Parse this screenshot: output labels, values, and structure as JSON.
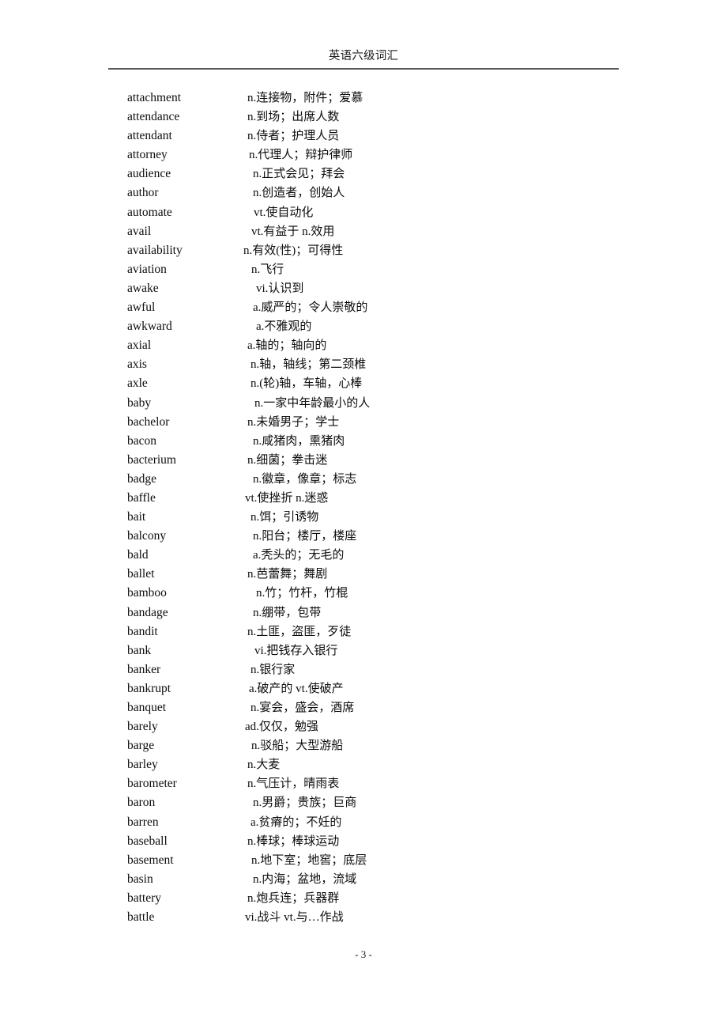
{
  "header": {
    "title": "英语六级词汇",
    "rule_color": "#595959"
  },
  "footer": {
    "page_label": "- 3 -"
  },
  "glossary": {
    "columns": [
      "word",
      "definition"
    ],
    "entries": [
      {
        "word": "attachment",
        "definition": "n.连接物，附件；爱慕",
        "indent": 313
      },
      {
        "word": "attendance",
        "definition": "n.到场；出席人数",
        "indent": 313
      },
      {
        "word": "attendant",
        "definition": "n.侍者；护理人员",
        "indent": 313
      },
      {
        "word": "attorney",
        "definition": "n.代理人；辩护律师",
        "indent": 315
      },
      {
        "word": "audience",
        "definition": "n.正式会见；拜会",
        "indent": 320
      },
      {
        "word": "author",
        "definition": "n.创造者，创始人",
        "indent": 320
      },
      {
        "word": "automate",
        "definition": "vt.使自动化",
        "indent": 321
      },
      {
        "word": "avail",
        "definition": "vt.有益于 n.效用",
        "indent": 318
      },
      {
        "word": "availability",
        "definition": "n.有效(性)；可得性",
        "indent": 308
      },
      {
        "word": "aviation",
        "definition": "n.飞行",
        "indent": 318
      },
      {
        "word": "awake",
        "definition": "vi.认识到",
        "indent": 324
      },
      {
        "word": "awful",
        "definition": "a.威严的；令人崇敬的",
        "indent": 320
      },
      {
        "word": "awkward",
        "definition": "a.不雅观的",
        "indent": 324
      },
      {
        "word": "axial",
        "definition": "a.轴的；轴向的",
        "indent": 313
      },
      {
        "word": "axis",
        "definition": "n.轴，轴线；第二颈椎",
        "indent": 317
      },
      {
        "word": "axle",
        "definition": "n.(轮)轴，车轴，心棒",
        "indent": 317
      },
      {
        "word": "baby",
        "definition": "n.一家中年龄最小的人",
        "indent": 322
      },
      {
        "word": "bachelor",
        "definition": "n.未婚男子；学士",
        "indent": 313
      },
      {
        "word": "bacon",
        "definition": "n.咸猪肉，熏猪肉",
        "indent": 320
      },
      {
        "word": "bacterium",
        "definition": "n.细菌；拳击迷",
        "indent": 313
      },
      {
        "word": "badge",
        "definition": "n.徽章，像章；标志",
        "indent": 320
      },
      {
        "word": "baffle",
        "definition": "vt.使挫折 n.迷惑",
        "indent": 310
      },
      {
        "word": "bait",
        "definition": "n.饵；引诱物",
        "indent": 317
      },
      {
        "word": "balcony",
        "definition": "n.阳台；楼厅，楼座",
        "indent": 320
      },
      {
        "word": "bald",
        "definition": "a.秃头的；无毛的",
        "indent": 320
      },
      {
        "word": "ballet",
        "definition": "n.芭蕾舞；舞剧",
        "indent": 313
      },
      {
        "word": "bamboo",
        "definition": "n.竹；竹杆，竹棍",
        "indent": 324
      },
      {
        "word": "bandage",
        "definition": "n.绷带，包带",
        "indent": 320
      },
      {
        "word": "bandit",
        "definition": "n.土匪，盗匪，歹徒",
        "indent": 313
      },
      {
        "word": "bank",
        "definition": "vi.把钱存入银行",
        "indent": 322
      },
      {
        "word": "banker",
        "definition": "n.银行家",
        "indent": 317
      },
      {
        "word": "bankrupt",
        "definition": "a.破产的 vt.使破产",
        "indent": 315
      },
      {
        "word": "banquet",
        "definition": "n.宴会，盛会，酒席",
        "indent": 317
      },
      {
        "word": "barely",
        "definition": "ad.仅仅，勉强",
        "indent": 310
      },
      {
        "word": "barge",
        "definition": "n.驳船；大型游船",
        "indent": 318
      },
      {
        "word": "barley",
        "definition": "n.大麦",
        "indent": 313
      },
      {
        "word": "barometer",
        "definition": "n.气压计，晴雨表",
        "indent": 313
      },
      {
        "word": "baron",
        "definition": "n.男爵；贵族；巨商",
        "indent": 320
      },
      {
        "word": "barren",
        "definition": "a.贫瘠的；不妊的",
        "indent": 317
      },
      {
        "word": "baseball",
        "definition": "n.棒球；棒球运动",
        "indent": 313
      },
      {
        "word": "basement",
        "definition": "n.地下室；地窖；底层",
        "indent": 318
      },
      {
        "word": "basin",
        "definition": "n.内海；盆地，流域",
        "indent": 320
      },
      {
        "word": "battery",
        "definition": "n.炮兵连；兵器群",
        "indent": 313
      },
      {
        "word": "battle",
        "definition": "vi.战斗 vt.与…作战",
        "indent": 310
      }
    ]
  }
}
